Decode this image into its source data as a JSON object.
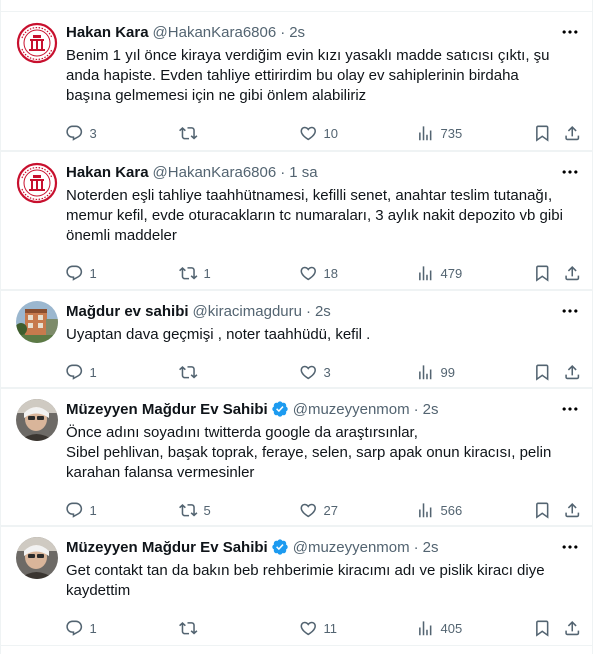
{
  "tweets": [
    {
      "name": "Hakan Kara",
      "handle": "@HakanKara6806",
      "time": "2s",
      "verified": false,
      "avatar": "seal-logo-avatar",
      "lines": [
        "Benim 1 yıl önce kiraya verdiğim evin kızı  yasaklı madde satıcısı çıktı, şu",
        "anda hapiste. Evden tahliye ettirirdim  bu olay ev sahiplerinin birdaha",
        "başına gelmemesi için ne gibi önlem alabiliriz"
      ],
      "replies": "3",
      "retweets": "",
      "likes": "10",
      "views": "735"
    },
    {
      "name": "Hakan Kara",
      "handle": "@HakanKara6806",
      "time": "1 sa",
      "verified": false,
      "avatar": "seal-logo-avatar",
      "lines": [
        "Noterden eşli tahliye taahhütnamesi, kefilli senet, anahtar teslim tutanağı,",
        "memur kefil, evde oturacakların tc numaraları, 3 aylık nakit depozito vb gibi",
        "önemli maddeler"
      ],
      "replies": "1",
      "retweets": "1",
      "likes": "18",
      "views": "479"
    },
    {
      "name": "Mağdur ev sahibi",
      "handle": "@kiracimagduru",
      "time": "2s",
      "verified": false,
      "avatar": "building-photo-avatar",
      "lines": [
        "Uyaptan dava geçmişi , noter taahhüdü, kefil ."
      ],
      "replies": "1",
      "retweets": "",
      "likes": "3",
      "views": "99"
    },
    {
      "name": "Müzeyyen Mağdur Ev Sahibi",
      "handle": "@muzeyyenmom",
      "time": "2s",
      "verified": true,
      "avatar": "person-photo-avatar",
      "lines": [
        "Önce adını soyadını twitterda google da araştırsınlar,",
        "Sibel pehlivan, başak toprak, feraye, selen, sarp apak onun kiracısı, pelin",
        "karahan falansa vermesinler"
      ],
      "replies": "1",
      "retweets": "5",
      "likes": "27",
      "views": "566"
    },
    {
      "name": "Müzeyyen Mağdur Ev Sahibi",
      "handle": "@muzeyyenmom",
      "time": "2s",
      "verified": true,
      "avatar": "person-photo-avatar",
      "lines": [
        "Get contakt tan da bakın beb rehberimie kiracımı adı ve pislik kiracı diye",
        "kaydettim"
      ],
      "replies": "1",
      "retweets": "",
      "likes": "11",
      "views": "405"
    }
  ],
  "colors": {
    "text": "#0f1419",
    "secondary": "#536471",
    "border": "#eff3f4",
    "verified": "#1d9bf0"
  },
  "icons": [
    "reply-icon",
    "retweet-icon",
    "like-icon",
    "views-icon",
    "bookmark-icon",
    "share-icon",
    "more-icon",
    "verified-badge-icon"
  ]
}
